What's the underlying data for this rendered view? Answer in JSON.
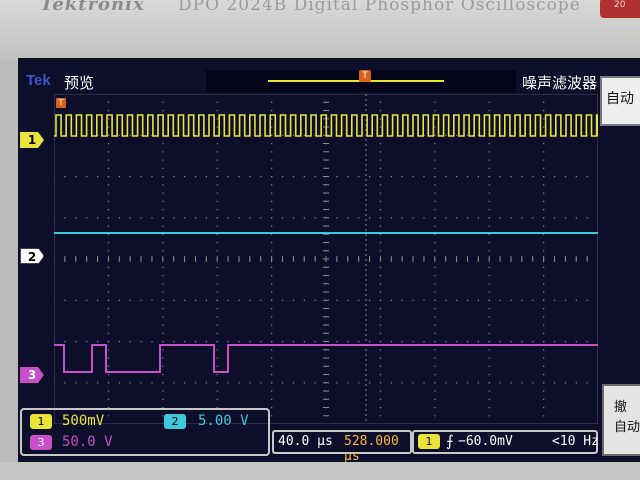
{
  "bezel": {
    "brand": "Tektronix",
    "model": "DPO 2024B Digital Phosphor Oscilloscope",
    "badge": "20"
  },
  "status": {
    "logo": "Tek",
    "mode": "预览",
    "filter": "噪声滤波器",
    "trigger_marker": "T"
  },
  "side_menu": {
    "top_label": "自动",
    "bottom_line1": "撤",
    "bottom_line2": "自动"
  },
  "channels": [
    {
      "id": "1",
      "label": "1",
      "color": "#e8e43a",
      "scale": "500mV",
      "signal": "square-wave"
    },
    {
      "id": "2",
      "label": "2",
      "color": "#3fc9dc",
      "scale": "5.00 V",
      "signal": "flat"
    },
    {
      "id": "3",
      "label": "3",
      "color": "#c84fc8",
      "scale": "50.0 V",
      "signal": "digital-pulses"
    }
  ],
  "horizontal": {
    "time_per_div": "40.0 μs",
    "position": "528.000 μs"
  },
  "trigger": {
    "source": "1",
    "slope": "rising-edge",
    "slope_symbol": "⨍",
    "level": "−60.0mV",
    "frequency": "<10 Hz"
  },
  "colors": {
    "screen_bg": "#0d0e2a",
    "grid": "#8a8a8a",
    "ch1": "#e8e43a",
    "ch2": "#3fc9dc",
    "ch3": "#c84fc8",
    "trigger_marker": "#d8621a"
  }
}
